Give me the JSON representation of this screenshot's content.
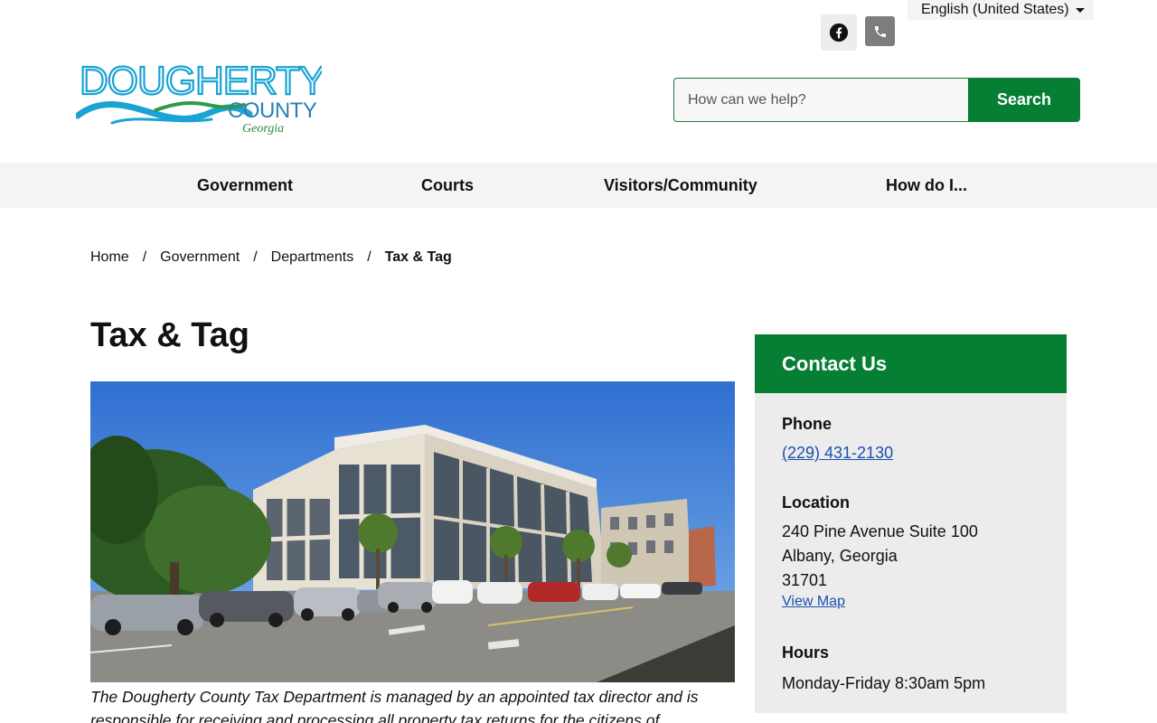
{
  "header": {
    "language": "English (United States)",
    "search_placeholder": "How can we help?",
    "search_button": "Search",
    "logo": {
      "line1": "DOUGHERTY",
      "line2": "COUNTY",
      "line3": "Georgia"
    },
    "social_icons": [
      "facebook-icon",
      "phone-icon"
    ]
  },
  "nav": {
    "items": [
      {
        "label": "Government"
      },
      {
        "label": "Courts"
      },
      {
        "label": "Visitors/Community"
      },
      {
        "label": "How do I..."
      }
    ]
  },
  "breadcrumb": {
    "items": [
      "Home",
      "Government",
      "Departments"
    ],
    "current": "Tax & Tag",
    "separator": "/"
  },
  "page": {
    "title": "Tax & Tag",
    "intro_line1": "The Dougherty County Tax Department is managed by an appointed tax director and is",
    "intro_line2": "responsible for receiving and processing all property tax returns for the citizens of"
  },
  "contact": {
    "heading": "Contact Us",
    "phone_label": "Phone",
    "phone": "(229) 431-2130",
    "location_label": "Location",
    "address1": "240 Pine Avenue Suite 100",
    "address2": "Albany, Georgia",
    "zip": "31701",
    "map_link": "View Map",
    "hours_label": "Hours",
    "hours": "Monday-Friday 8:30am 5pm"
  },
  "colors": {
    "brand_green": "#067f35",
    "link_blue": "#1d4fb0",
    "logo_blue": "#1aa3d4"
  }
}
